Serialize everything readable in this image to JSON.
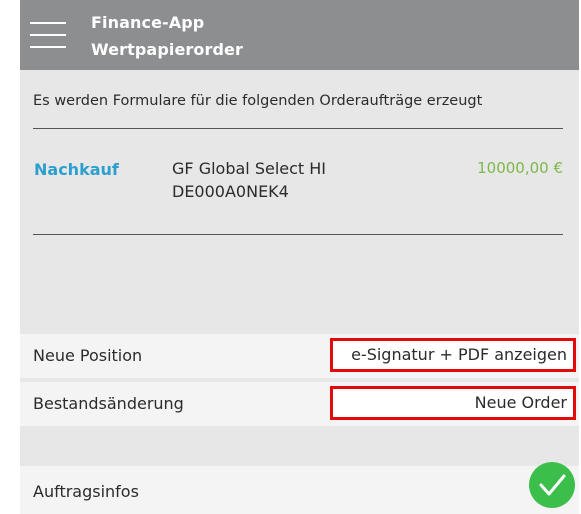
{
  "header": {
    "app_name": "Finance-App",
    "page_title": "Wertpapierorder"
  },
  "content": {
    "intro": "Es werden Formulare für die folgenden Orderaufträge erzeugt",
    "order": {
      "type": "Nachkauf",
      "name": "GF Global Select HI",
      "isin": "DE000A0NEK4",
      "amount": "10000,00 €"
    }
  },
  "rows": {
    "neue_position": {
      "label": "Neue Position",
      "action_label": "e-Signatur + PDF anzeigen"
    },
    "bestandsaenderung": {
      "label": "Bestandsänderung",
      "action_label": "Neue Order"
    },
    "auftragsinfos": {
      "label": "Auftragsinfos",
      "status_icon": "check-icon"
    }
  },
  "colors": {
    "header_bg": "#8d8e90",
    "accent_blue": "#2d9fcf",
    "amount_green": "#7cb84a",
    "highlight_red": "#e10b0b",
    "check_green": "#3bbf4a"
  }
}
